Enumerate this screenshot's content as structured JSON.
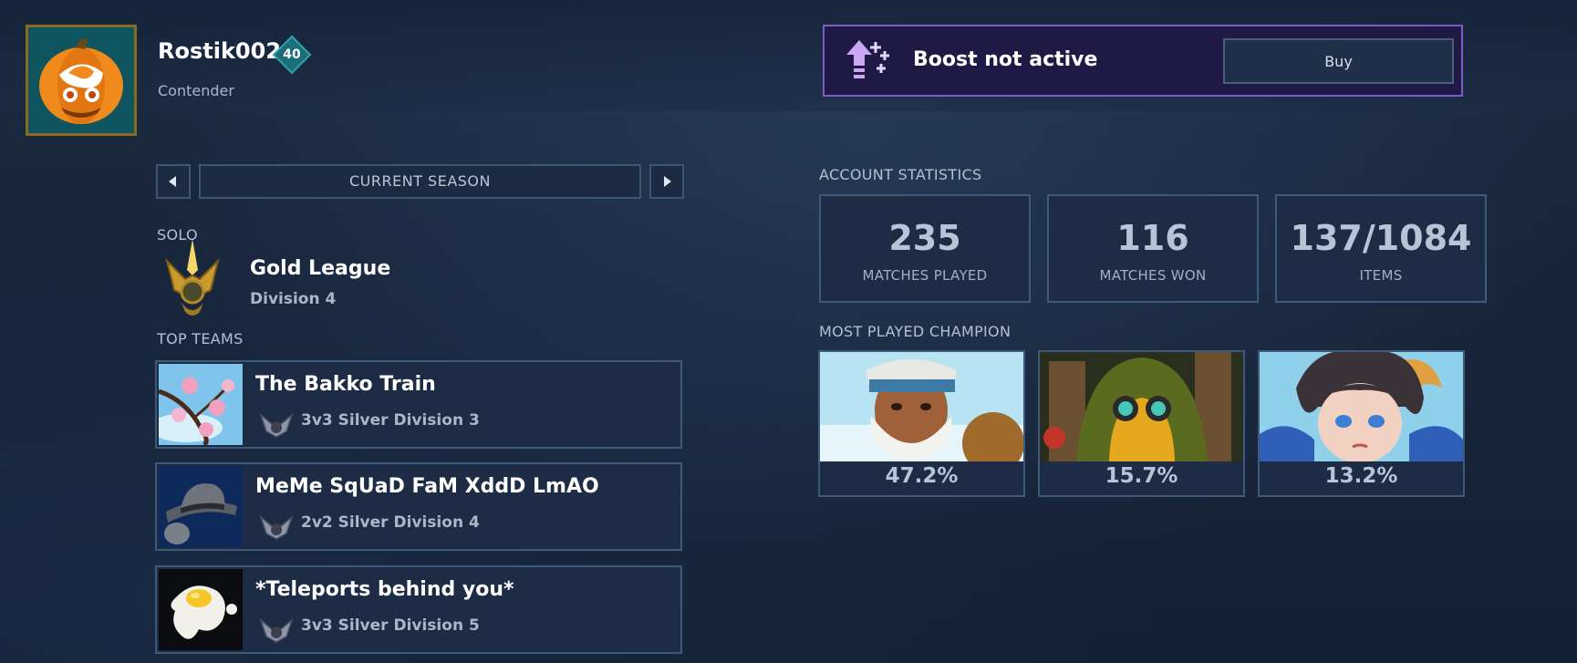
{
  "profile": {
    "username": "Rostik002",
    "level": "40",
    "rank_title": "Contender"
  },
  "boost": {
    "status": "Boost not active",
    "buy_label": "Buy",
    "icon": "boost-arrow-icon"
  },
  "season": {
    "label": "CURRENT SEASON"
  },
  "solo": {
    "section_label": "SOLO",
    "league": "Gold League",
    "division": "Division 4"
  },
  "teams": {
    "section_label": "TOP TEAMS",
    "items": [
      {
        "name": "The Bakko Train",
        "rank": "3v3 Silver Division 3"
      },
      {
        "name": "MeMe SqUaD FaM XddD LmAO",
        "rank": "2v2 Silver Division 4"
      },
      {
        "name": "*Teleports behind you*",
        "rank": "3v3 Silver Division 5"
      }
    ]
  },
  "stats": {
    "section_label": "ACCOUNT STATISTICS",
    "items": [
      {
        "value": "235",
        "label": "MATCHES PLAYED"
      },
      {
        "value": "116",
        "label": "MATCHES WON"
      },
      {
        "value": "137/1084",
        "label": "ITEMS"
      }
    ]
  },
  "champions": {
    "section_label": "MOST PLAYED CHAMPION",
    "items": [
      {
        "percent": "47.2%"
      },
      {
        "percent": "15.7%"
      },
      {
        "percent": "13.2%"
      }
    ]
  },
  "colors": {
    "boost_border": "#7b5cc8",
    "panel_bg": "#1d2c44",
    "panel_border": "#3e5a7a"
  }
}
